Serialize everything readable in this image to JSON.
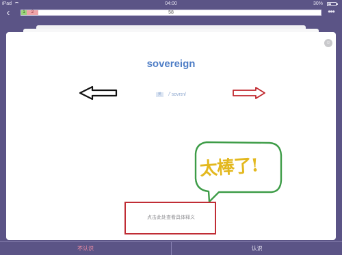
{
  "status_bar": {
    "device": "iPad",
    "time": "04:00",
    "battery_text": "30%",
    "battery_level": 0.3
  },
  "progress": {
    "known_count": "1",
    "unknown_count": "2",
    "total": "58"
  },
  "card": {
    "word": "sovereign",
    "speaker_label": "英",
    "phonetic": "/ˈsɒvrɪn/",
    "definition_hint": "点击此处查看具体释义"
  },
  "annotation": {
    "sticker_text": "太棒了!",
    "colors": {
      "left_arrow": "#111111",
      "right_arrow": "#c0262c",
      "hint_box": "#c02d35",
      "bubble": "#3d9c47",
      "sticker_text": "#e3b81e"
    }
  },
  "actions": {
    "unknown_label": "不认识",
    "known_label": "认识"
  },
  "icons": [
    "back-chevron-icon",
    "more-options-icon",
    "wifi-icon",
    "battery-icon",
    "card-options-icon",
    "speaker-icon"
  ],
  "theme": {
    "background": "#5b5486",
    "word_color": "#4f7ec6"
  }
}
